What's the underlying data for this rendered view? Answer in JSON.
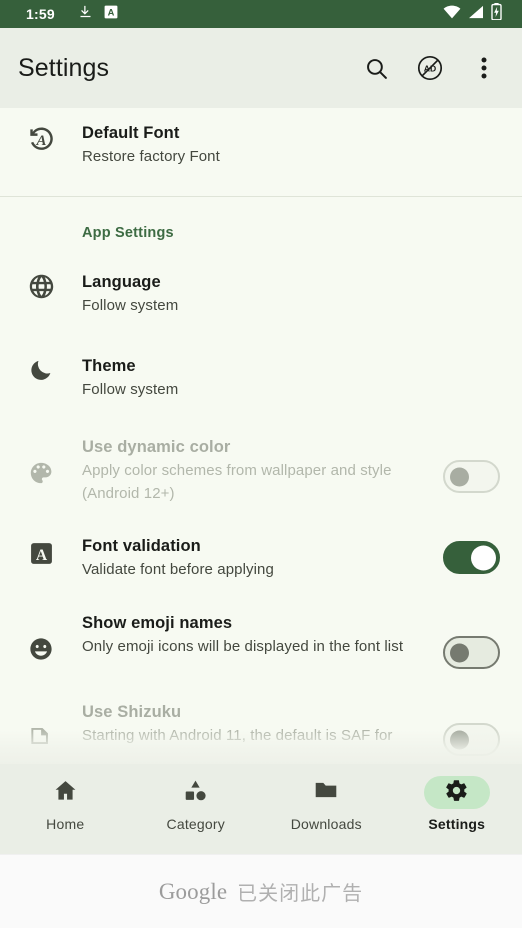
{
  "status_bar": {
    "time": "1:59",
    "left_icons": [
      "download-icon",
      "app-notification-a-icon"
    ],
    "right_icons": [
      "wifi-icon",
      "cellular-signal-icon",
      "battery-charging-icon"
    ],
    "background_color": "#36603b"
  },
  "toolbar": {
    "title": "Settings",
    "actions": [
      {
        "name": "search-icon",
        "label": "Search"
      },
      {
        "name": "remove-ads-icon",
        "label": "AD"
      },
      {
        "name": "overflow-menu-icon",
        "label": "More options"
      }
    ]
  },
  "list": {
    "top_row": {
      "icon": "restore-font-icon",
      "title": "Default Font",
      "subtitle": "Restore factory Font"
    },
    "section_header": "App Settings",
    "items": [
      {
        "icon": "globe-icon",
        "title": "Language",
        "subtitle": "Follow system",
        "control": "none",
        "disabled": false
      },
      {
        "icon": "moon-icon",
        "title": "Theme",
        "subtitle": "Follow system",
        "control": "none",
        "disabled": false
      },
      {
        "icon": "palette-icon",
        "title": "Use dynamic color",
        "subtitle": "Apply color schemes from wallpaper and style (Android 12+)",
        "control": "switch",
        "switch_state": "off",
        "disabled": true
      },
      {
        "icon": "font-box-a-icon",
        "title": "Font validation",
        "subtitle": "Validate font before applying",
        "control": "switch",
        "switch_state": "on",
        "disabled": false
      },
      {
        "icon": "emoji-face-icon",
        "title": "Show emoji names",
        "subtitle": "Only emoji icons will be displayed in the font list",
        "control": "switch",
        "switch_state": "off",
        "disabled": false
      },
      {
        "icon": "shizuku-file-icon",
        "title": "Use Shizuku",
        "subtitle": "Starting with Android 11, the default is SAF for",
        "control": "switch",
        "switch_state": "off",
        "disabled": true
      }
    ]
  },
  "bottom_nav": {
    "items": [
      {
        "icon": "home-icon",
        "label": "Home",
        "active": false
      },
      {
        "icon": "category-shapes-icon",
        "label": "Category",
        "active": false
      },
      {
        "icon": "folder-icon",
        "label": "Downloads",
        "active": false
      },
      {
        "icon": "gear-icon",
        "label": "Settings",
        "active": true
      }
    ],
    "active_pill_color": "#c5e7c6"
  },
  "ad_banner": {
    "brand": "Google",
    "message": "已关闭此广告"
  }
}
